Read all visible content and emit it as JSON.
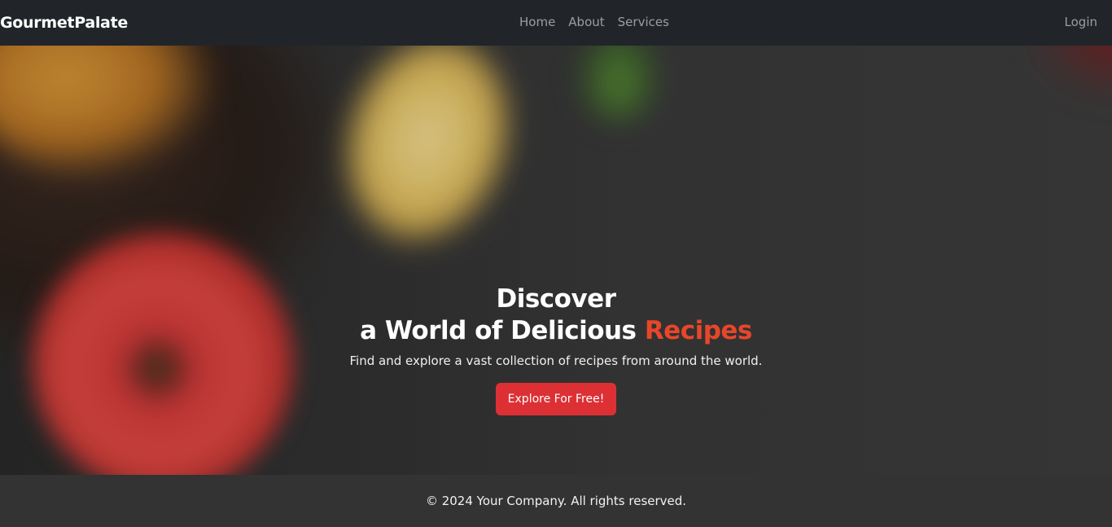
{
  "navbar": {
    "brand": "GourmetPalate",
    "links": [
      "Home",
      "About",
      "Services"
    ],
    "login": "Login"
  },
  "hero": {
    "title_line1": "Discover",
    "title_line2_prefix": "a World of Delicious ",
    "title_line2_accent": "Recipes",
    "subtitle": "Find and explore a vast collection of recipes from around the world.",
    "cta_label": "Explore For Free!"
  },
  "footer": {
    "text": "© 2024 Your Company. All rights reserved."
  },
  "colors": {
    "navbar_bg": "#212529",
    "accent": "#e8462a",
    "cta_bg": "#dc3035",
    "footer_bg": "#333333"
  }
}
